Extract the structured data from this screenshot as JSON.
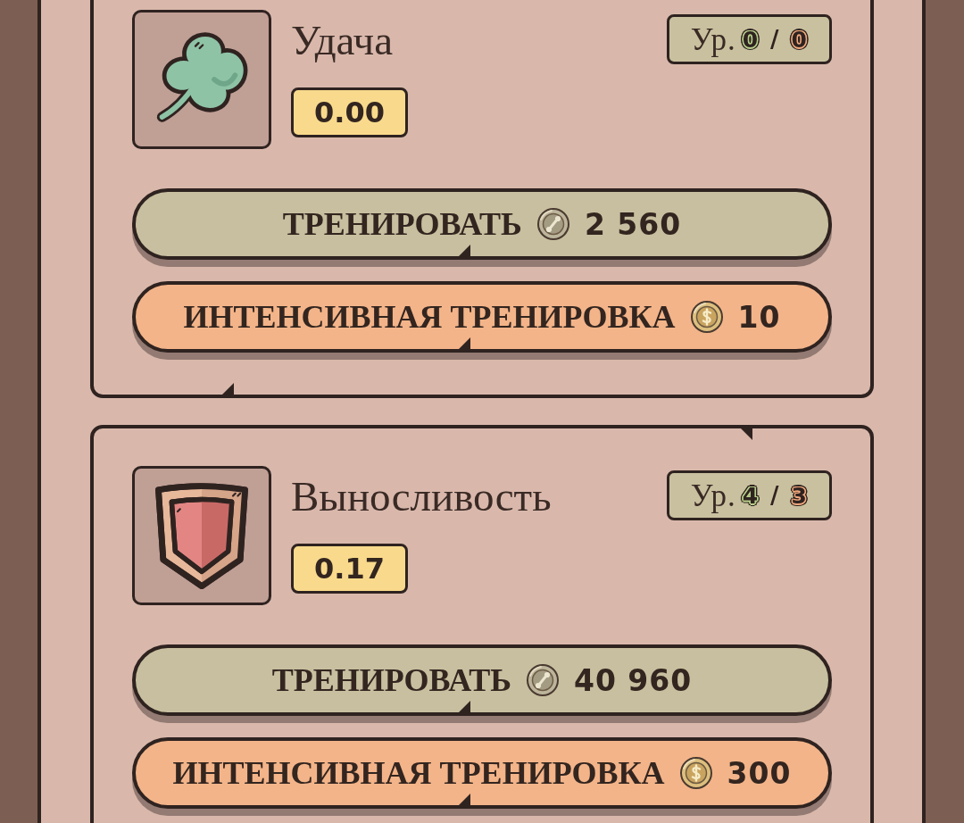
{
  "cards": [
    {
      "kind": "clover",
      "name": "Удача",
      "value": "0.00",
      "tier": {
        "prefix": "Ур.",
        "current": "0",
        "separator": "/",
        "max": "0"
      },
      "buttons": [
        {
          "kind": "train",
          "label": "ТРЕНИРОВАТЬ",
          "price": "2 560"
        },
        {
          "kind": "intensive",
          "label": "ИНТЕНСИВНАЯ ТРЕНИРОВКА",
          "price": "10"
        }
      ]
    },
    {
      "kind": "shield",
      "name": "Выносливость",
      "value": "0.17",
      "tier": {
        "prefix": "Ур.",
        "current": "4",
        "separator": "/",
        "max": "3"
      },
      "buttons": [
        {
          "kind": "train",
          "label": "ТРЕНИРОВАТЬ",
          "price": "40 960"
        },
        {
          "kind": "intensive",
          "label": "ИНТЕНСИВНАЯ ТРЕНИРОВКА",
          "price": "300"
        }
      ]
    }
  ]
}
